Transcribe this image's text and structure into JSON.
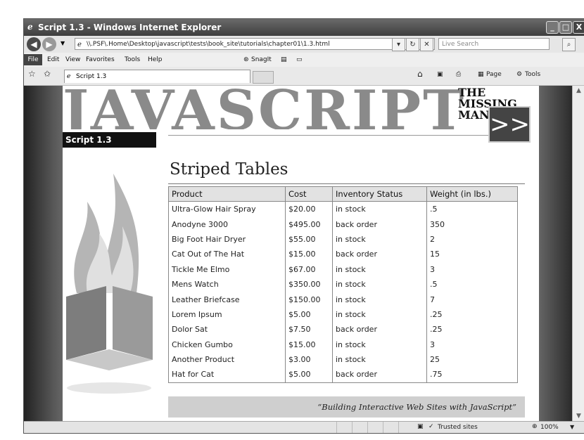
{
  "window": {
    "title": "Script 1.3 - Windows Internet Explorer",
    "minimize": "_",
    "maximize": "□",
    "close": "X"
  },
  "address": {
    "url": "\\\\.PSF\\.Home\\Desktop\\javascript\\tests\\book_site\\tutorials\\chapter01\\1.3.html",
    "search_placeholder": "Live Search"
  },
  "menu": {
    "items": [
      "File",
      "Edit",
      "View",
      "Favorites",
      "Tools",
      "Help"
    ],
    "snagit": "SnagIt"
  },
  "tab": {
    "label": "Script 1.3",
    "page_label": "Page",
    "tools_label": "Tools"
  },
  "site": {
    "banner_big": "JAVASCRIPT",
    "banner_line1": "THE",
    "banner_line2": "MISSING",
    "banner_line3": "MANUAL",
    "arrow": ">>",
    "sidebar_title": "Script 1.3",
    "heading": "Striped Tables",
    "footer": "“Building Interactive Web Sites with JavaScript”"
  },
  "table": {
    "columns": [
      "Product",
      "Cost",
      "Inventory Status",
      "Weight (in lbs.)"
    ],
    "rows": [
      [
        "Ultra-Glow Hair Spray",
        "$20.00",
        "in stock",
        ".5"
      ],
      [
        "Anodyne 3000",
        "$495.00",
        "back order",
        "350"
      ],
      [
        "Big Foot Hair Dryer",
        "$55.00",
        "in stock",
        "2"
      ],
      [
        "Cat Out of The Hat",
        "$15.00",
        "back order",
        "15"
      ],
      [
        "Tickle Me Elmo",
        "$67.00",
        "in stock",
        "3"
      ],
      [
        "Mens Watch",
        "$350.00",
        "in stock",
        ".5"
      ],
      [
        "Leather Briefcase",
        "$150.00",
        "in stock",
        "7"
      ],
      [
        "Lorem Ipsum",
        "$5.00",
        "in stock",
        ".25"
      ],
      [
        "Dolor Sat",
        "$7.50",
        "back order",
        ".25"
      ],
      [
        "Chicken Gumbo",
        "$15.00",
        "in stock",
        "3"
      ],
      [
        "Another Product",
        "$3.00",
        "in stock",
        "25"
      ],
      [
        "Hat for Cat",
        "$5.00",
        "back order",
        ".75"
      ]
    ]
  },
  "status": {
    "zone": "Trusted sites",
    "zoom": "100%"
  }
}
